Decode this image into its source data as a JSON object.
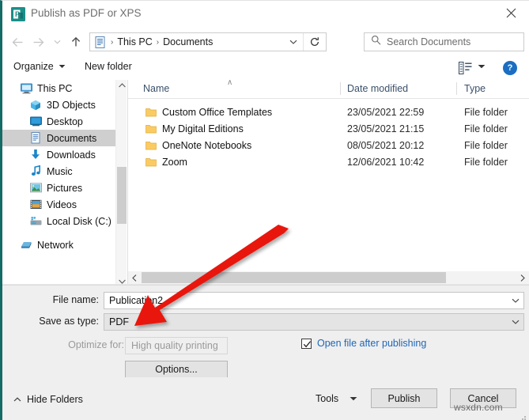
{
  "window": {
    "title": "Publish as PDF or XPS",
    "app_icon": "publisher-icon",
    "close_icon": "close-icon",
    "accent_color": "#156b66"
  },
  "navbar": {
    "back_icon": "back-arrow-icon",
    "forward_icon": "forward-arrow-icon",
    "recent_icon": "recent-locations-icon",
    "up_icon": "up-arrow-icon",
    "address_icon": "documents-folder-icon",
    "breadcrumbs": [
      "This PC",
      "Documents"
    ],
    "separator": "›",
    "dropdown_icon": "chevron-down-icon",
    "refresh_icon": "refresh-icon",
    "refresh_glyph": "↻"
  },
  "search": {
    "icon": "search-icon",
    "placeholder": "Search Documents"
  },
  "commandbar": {
    "organize_label": "Organize",
    "new_folder_label": "New folder",
    "view_icon": "view-layout-icon",
    "view_caret_icon": "chevron-down-icon",
    "help_icon": "help-icon",
    "help_glyph": "?"
  },
  "tree": {
    "items": [
      {
        "label": "This PC",
        "icon": "this-pc-icon",
        "indent": false,
        "selected": false
      },
      {
        "label": "3D Objects",
        "icon": "3d-objects-icon",
        "indent": true,
        "selected": false
      },
      {
        "label": "Desktop",
        "icon": "desktop-icon",
        "indent": true,
        "selected": false
      },
      {
        "label": "Documents",
        "icon": "documents-icon",
        "indent": true,
        "selected": true
      },
      {
        "label": "Downloads",
        "icon": "downloads-icon",
        "indent": true,
        "selected": false
      },
      {
        "label": "Music",
        "icon": "music-icon",
        "indent": true,
        "selected": false
      },
      {
        "label": "Pictures",
        "icon": "pictures-icon",
        "indent": true,
        "selected": false
      },
      {
        "label": "Videos",
        "icon": "videos-icon",
        "indent": true,
        "selected": false
      },
      {
        "label": "Local Disk (C:)",
        "icon": "local-disk-icon",
        "indent": true,
        "selected": false
      },
      {
        "label": "Network",
        "icon": "network-icon",
        "indent": false,
        "selected": false
      }
    ],
    "scroll_up_icon": "chevron-up-icon",
    "scroll_down_icon": "chevron-down-icon"
  },
  "filelist": {
    "columns": [
      "Name",
      "Date modified",
      "Type"
    ],
    "sort_indicator": "∧",
    "rows": [
      {
        "name": "Custom Office Templates",
        "date": "23/05/2021 22:59",
        "type": "File folder",
        "icon": "folder-icon"
      },
      {
        "name": "My Digital Editions",
        "date": "23/05/2021 21:15",
        "type": "File folder",
        "icon": "folder-icon"
      },
      {
        "name": "OneNote Notebooks",
        "date": "08/05/2021 20:12",
        "type": "File folder",
        "icon": "folder-icon"
      },
      {
        "name": "Zoom",
        "date": "12/06/2021 10:42",
        "type": "File folder",
        "icon": "folder-icon"
      }
    ],
    "hscroll_left_icon": "chevron-left-icon",
    "hscroll_right_icon": "chevron-right-icon"
  },
  "form": {
    "filename_label": "File name:",
    "filename_value": "Publication2",
    "savetype_label": "Save as type:",
    "savetype_value": "PDF",
    "optimize_label": "Optimize for:",
    "optimize_value": "High quality printing",
    "options_button": "Options...",
    "open_after_label": "Open file after publishing",
    "open_after_checked": true,
    "open_after_link_color": "#1f66b5",
    "dropdown_icon": "chevron-down-icon",
    "check_icon": "checkmark-icon"
  },
  "footer": {
    "hide_folders_label": "Hide Folders",
    "hide_folders_icon": "chevron-up-icon",
    "tools_label": "Tools",
    "tools_caret_icon": "chevron-down-icon",
    "publish_label": "Publish",
    "cancel_label": "Cancel",
    "resize_grip_icon": "resize-grip-icon"
  },
  "annotation": {
    "arrow_color": "#e8160c",
    "arrow_icon": "red-pointer-arrow",
    "points_to": "Save as type: PDF"
  },
  "watermark": {
    "text": "wsxdn.com"
  }
}
